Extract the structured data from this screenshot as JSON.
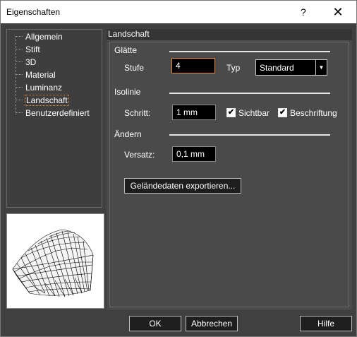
{
  "window": {
    "title": "Eigenschaften",
    "help_glyph": "?",
    "close_glyph": "✕"
  },
  "tree": {
    "items": [
      {
        "label": "Allgemein"
      },
      {
        "label": "Stift"
      },
      {
        "label": "3D"
      },
      {
        "label": "Material"
      },
      {
        "label": "Luminanz"
      },
      {
        "label": "Landschaft",
        "selected": true
      },
      {
        "label": "Benutzerdefiniert"
      }
    ]
  },
  "panel": {
    "header": "Landschaft",
    "smoothness": {
      "section_label": "Glätte",
      "stufe_label": "Stufe",
      "stufe_value": "4",
      "typ_label": "Typ",
      "typ_value": "Standard"
    },
    "isoline": {
      "section_label": "Isolinie",
      "schritt_label": "Schritt:",
      "schritt_value": "1 mm",
      "sichtbar_label": "Sichtbar",
      "sichtbar_checked": true,
      "beschriftung_label": "Beschriftung",
      "beschriftung_checked": true
    },
    "change": {
      "section_label": "Ändern",
      "versatz_label": "Versatz:",
      "versatz_value": "0,1 mm"
    },
    "export_button": "Geländedaten exportieren..."
  },
  "footer": {
    "ok": "OK",
    "cancel": "Abbrechen",
    "help": "Hilfe"
  },
  "colors": {
    "accent_focus": "#e08a3c",
    "panel_bg": "#4a4a4a",
    "dark_bg": "#404040"
  },
  "icons": {
    "check": "check-icon",
    "dropdown": "chevron-down-icon",
    "terrain": "terrain-mesh-preview"
  }
}
